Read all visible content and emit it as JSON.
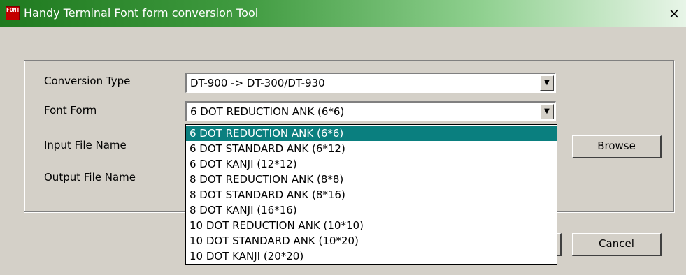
{
  "window": {
    "title": "Handy Terminal Font form conversion Tool",
    "icon_name": "font-tool-icon",
    "icon_text": "FONT",
    "close_glyph": "×"
  },
  "form": {
    "conversion_type": {
      "label": "Conversion Type",
      "value": "DT-900 -> DT-300/DT-930"
    },
    "font_form": {
      "label": "Font Form",
      "value": "6 DOT REDUCTION ANK (6*6)"
    },
    "input_file": {
      "label": "Input File Name"
    },
    "output_file": {
      "label": "Output File Name"
    }
  },
  "dropdown": {
    "options": [
      "6 DOT REDUCTION ANK (6*6)",
      "6 DOT STANDARD ANK (6*12)",
      "6 DOT KANJI (12*12)",
      "8 DOT REDUCTION ANK (8*8)",
      "8 DOT STANDARD ANK (8*16)",
      "8 DOT KANJI (16*16)",
      "10 DOT REDUCTION ANK (10*10)",
      "10 DOT STANDARD ANK (10*20)",
      "10 DOT KANJI (20*20)"
    ],
    "selected_index": 0
  },
  "buttons": {
    "browse": "Browse",
    "cancel": "Cancel"
  },
  "colors": {
    "selection": "#0a7f7f",
    "titlebar_start": "#1f7a1f",
    "dialog_bg": "#d4d0c8"
  }
}
